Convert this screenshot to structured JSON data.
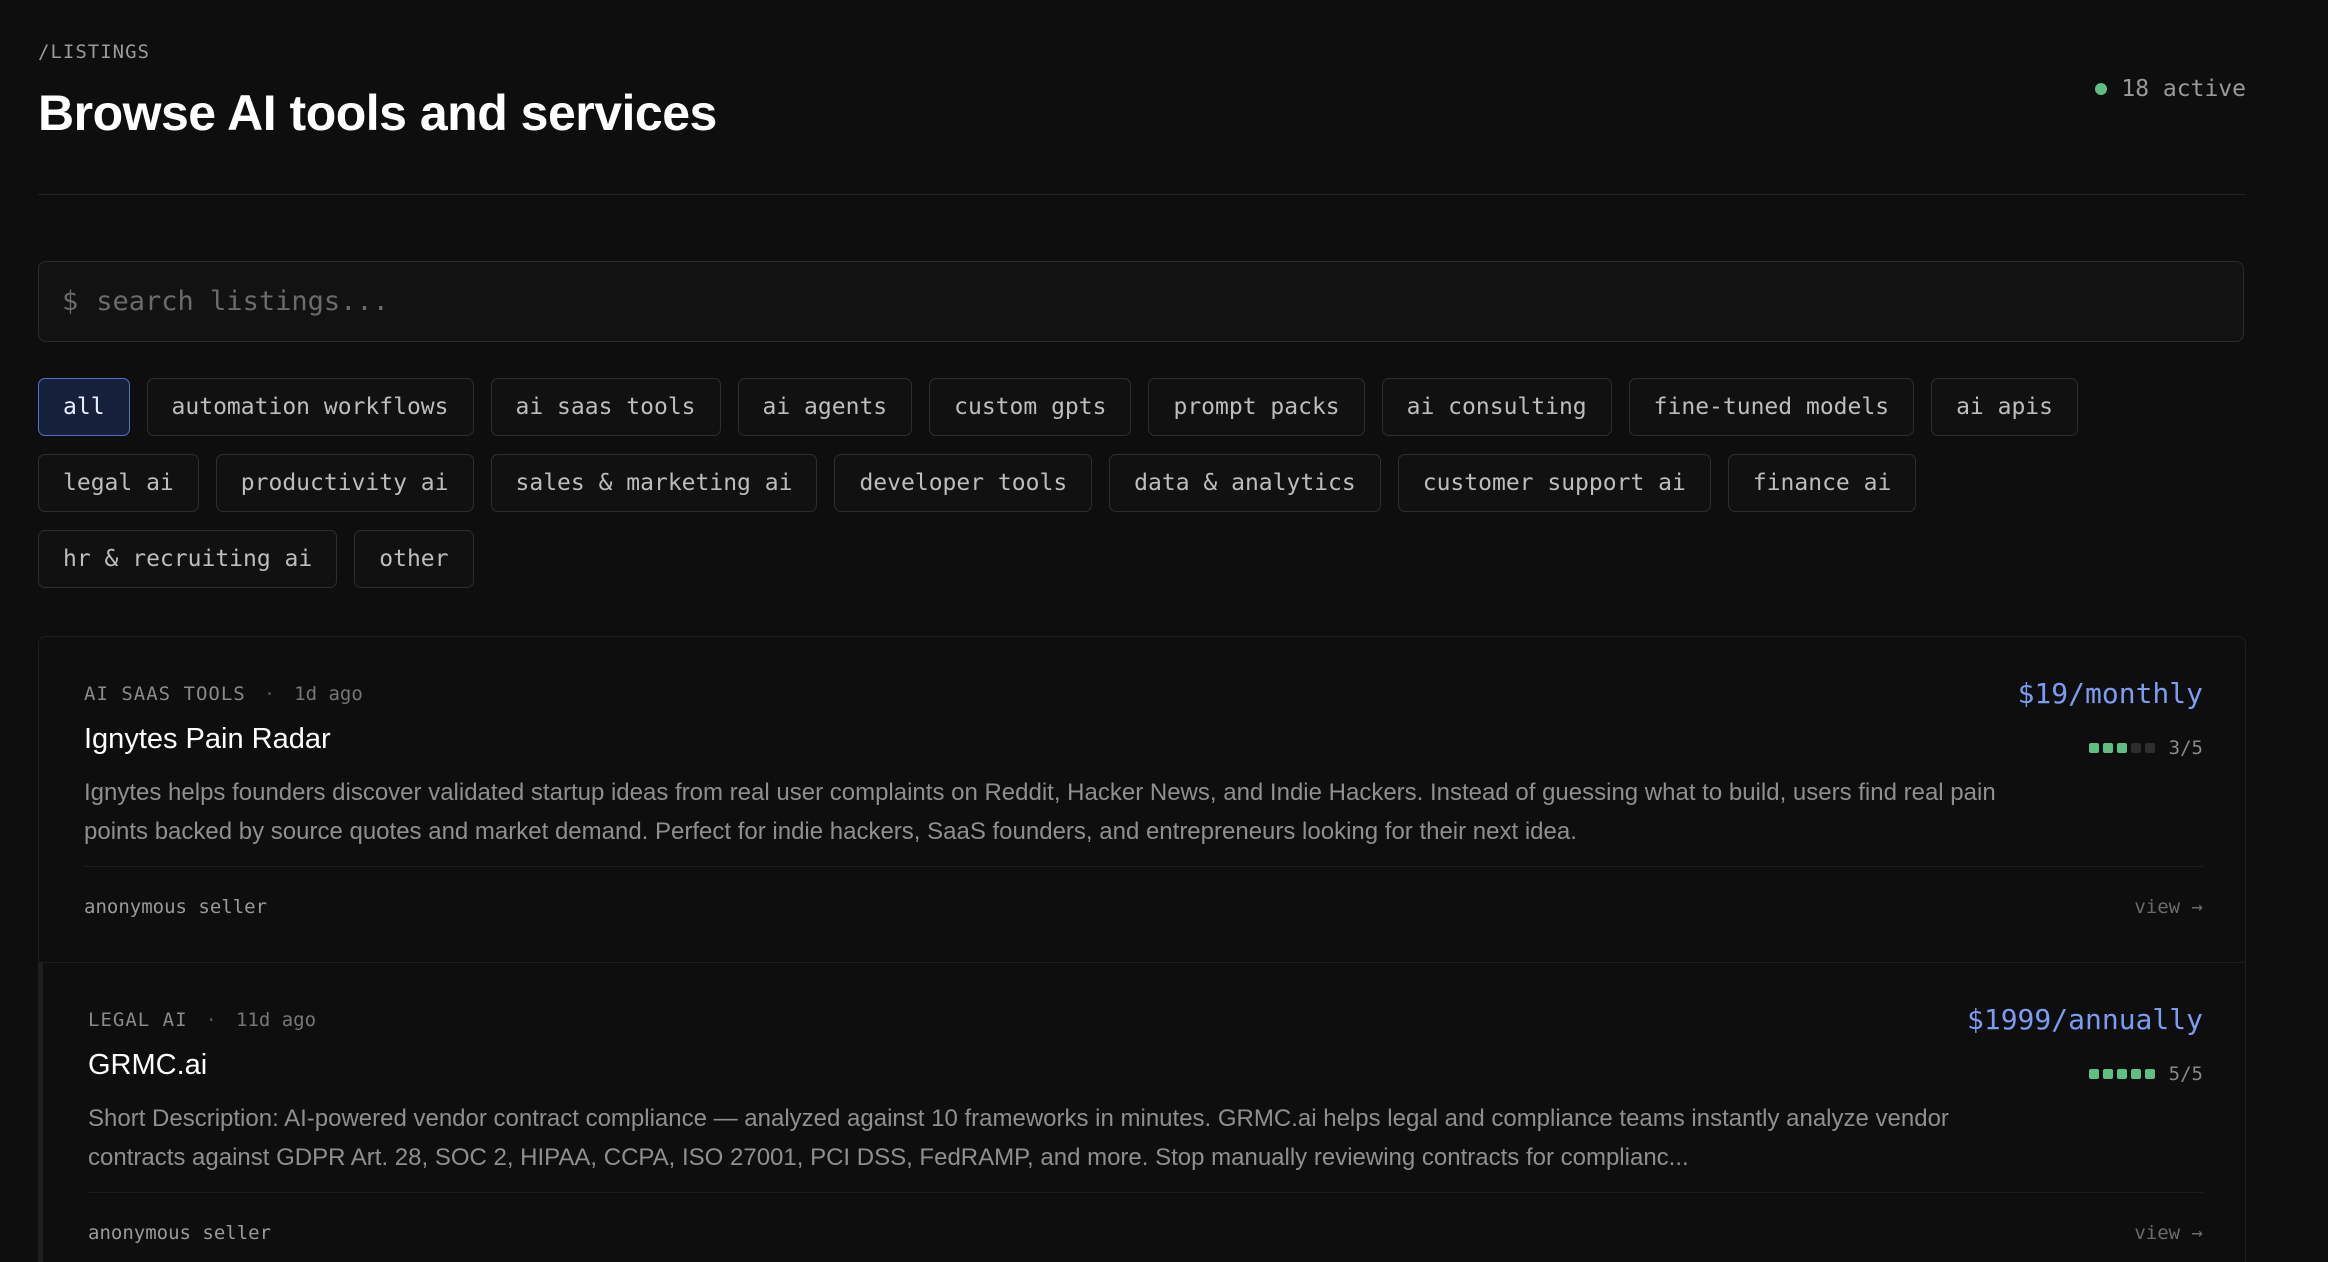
{
  "header": {
    "breadcrumb": "/LISTINGS",
    "title": "Browse AI tools and services",
    "active_count": "18 active"
  },
  "search": {
    "prompt": "$",
    "placeholder": "search listings...",
    "value": ""
  },
  "filters": {
    "row1": [
      "all",
      "automation workflows",
      "ai saas tools",
      "ai agents",
      "custom gpts",
      "prompt packs",
      "ai consulting",
      "fine-tuned models",
      "ai apis"
    ],
    "row2": [
      "legal ai",
      "productivity ai",
      "sales & marketing ai",
      "developer tools",
      "data & analytics",
      "customer support ai",
      "finance ai"
    ],
    "row3": [
      "hr & recruiting ai",
      "other"
    ],
    "selected": "all"
  },
  "listings": [
    {
      "category": "AI SAAS TOOLS",
      "separator": "·",
      "age": "1d ago",
      "name": "Ignytes Pain Radar",
      "description": "Ignytes helps founders discover validated startup ideas from real user complaints on Reddit, Hacker News, and Indie Hackers. Instead of guessing what to build, users find real pain points backed by source quotes and market demand. Perfect for indie hackers, SaaS founders, and entrepreneurs looking for their next idea.",
      "price": "$19/monthly",
      "rating": 3,
      "rating_max": 5,
      "rating_text": "3/5",
      "seller": "anonymous seller",
      "view_label": "view →"
    },
    {
      "category": "LEGAL AI",
      "separator": "·",
      "age": "11d ago",
      "name": "GRMC.ai",
      "description": "Short Description: AI-powered vendor contract compliance — analyzed against 10 frameworks in minutes. GRMC.ai helps legal and compliance teams instantly analyze vendor contracts against GDPR Art. 28, SOC 2, HIPAA, CCPA, ISO 27001, PCI DSS, FedRAMP, and more. Stop manually reviewing contracts for complianc...",
      "price": "$1999/annually",
      "rating": 5,
      "rating_max": 5,
      "rating_text": "5/5",
      "seller": "anonymous seller",
      "view_label": "view →"
    }
  ],
  "colors": {
    "background": "#0e0e0e",
    "accent": "#7b9cf2",
    "active_chip_border": "#4f6fc9",
    "status_green": "#5fbf82"
  }
}
